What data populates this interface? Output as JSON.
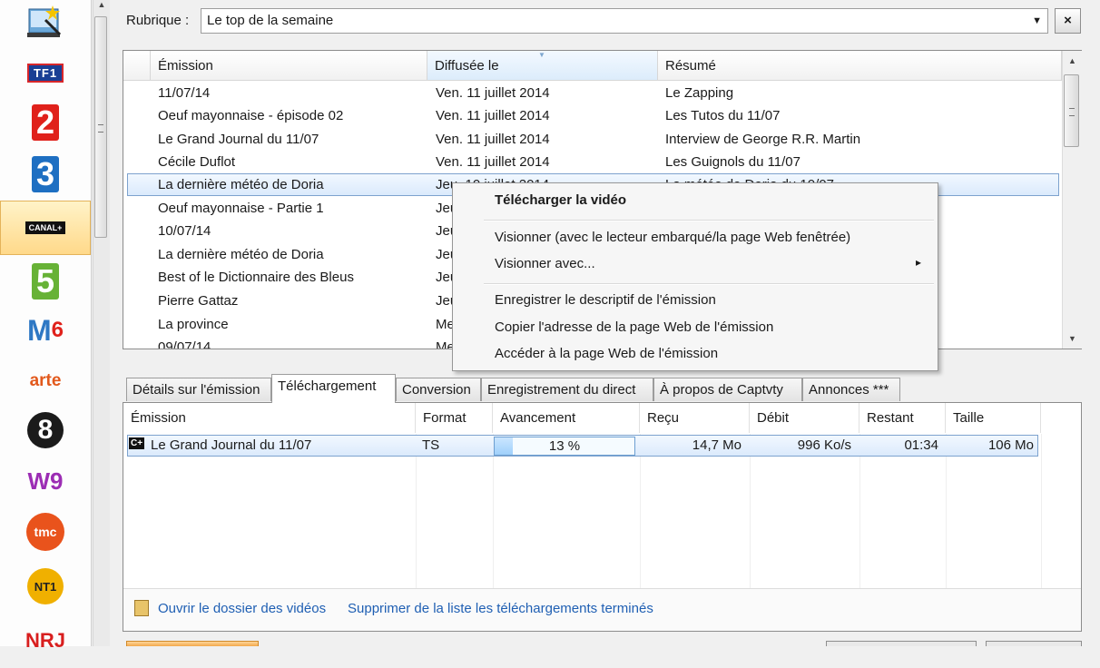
{
  "sidebar": {
    "channels": [
      {
        "name": "TF1",
        "logo": "tf1-logo",
        "color": "#1a3f94"
      },
      {
        "name": "2",
        "logo": "france2-logo",
        "color": "#e0211b"
      },
      {
        "name": "3",
        "logo": "france3-logo",
        "color": "#1e6fc2"
      },
      {
        "name": "CANAL+",
        "logo": "canalplus-logo",
        "color": "#111111",
        "selected": true
      },
      {
        "name": "5",
        "logo": "france5-logo",
        "color": "#67b236"
      },
      {
        "name": "6",
        "logo": "m6-logo",
        "color": "#2f78c4"
      },
      {
        "name": "arte",
        "logo": "arte-logo",
        "color": "#e2591c"
      },
      {
        "name": "8",
        "logo": "d8-logo",
        "color": "#1b1b1b"
      },
      {
        "name": "W9",
        "logo": "w9-logo",
        "color": "#9c2db4"
      },
      {
        "name": "tmc",
        "logo": "tmc-logo",
        "color": "#e9531c"
      },
      {
        "name": "NT1",
        "logo": "nt1-logo",
        "color": "#f0b000"
      },
      {
        "name": "NRJ",
        "logo": "nrj12-logo",
        "color": "#d81e1e"
      }
    ]
  },
  "rubrique": {
    "label": "Rubrique :",
    "value": "Le top de la semaine",
    "close": "×"
  },
  "list": {
    "columns": [
      "Émission",
      "Diffusée le",
      "Résumé"
    ],
    "rows": [
      {
        "emission": "11/07/14",
        "date": "Ven. 11 juillet 2014",
        "resume": "Le Zapping"
      },
      {
        "emission": "Oeuf mayonnaise - épisode 02",
        "date": "Ven. 11 juillet 2014",
        "resume": "Les Tutos du 11/07"
      },
      {
        "emission": "Le Grand Journal du 11/07",
        "date": "Ven. 11 juillet 2014",
        "resume": "Interview de George R.R. Martin"
      },
      {
        "emission": "Cécile Duflot",
        "date": "Ven. 11 juillet 2014",
        "resume": "Les Guignols du 11/07"
      },
      {
        "emission": "La dernière météo de Doria",
        "date": "Jeu. 10 juillet 2014",
        "resume": "La météo de Doria du 10/07"
      },
      {
        "emission": "Oeuf mayonnaise - Partie 1",
        "date": "Jeu",
        "resume": ""
      },
      {
        "emission": "10/07/14",
        "date": "Jeu",
        "resume": ""
      },
      {
        "emission": "La dernière météo de Doria",
        "date": "Jeu",
        "resume": ""
      },
      {
        "emission": "Best of le Dictionnaire des Bleus",
        "date": "Jeu",
        "resume": ""
      },
      {
        "emission": "Pierre Gattaz",
        "date": "Jeu",
        "resume": ""
      },
      {
        "emission": "La province",
        "date": "Me",
        "resume": ""
      },
      {
        "emission": "09/07/14",
        "date": "Me",
        "resume": ""
      }
    ]
  },
  "context_menu": {
    "items": [
      {
        "label": "Télécharger la vidéo",
        "bold": true
      },
      {
        "label": "Visionner (avec le lecteur embarqué/la page Web fenêtrée)"
      },
      {
        "label": "Visionner avec...",
        "submenu": "▸"
      },
      {
        "label": "Enregistrer le descriptif de l'émission"
      },
      {
        "label": "Copier l'adresse de la page Web de l'émission"
      },
      {
        "label": "Accéder à la page Web de l'émission"
      }
    ]
  },
  "tabs": [
    {
      "label": "Détails sur l'émission"
    },
    {
      "label": "Téléchargement",
      "active": true
    },
    {
      "label": "Conversion"
    },
    {
      "label": "Enregistrement du direct"
    },
    {
      "label": "À propos de Captvty"
    },
    {
      "label": "Annonces ***"
    }
  ],
  "downloads": {
    "columns": [
      "Émission",
      "Format",
      "Avancement",
      "Reçu",
      "Débit",
      "Restant",
      "Taille"
    ],
    "rows": [
      {
        "icon": "canalplus-icon",
        "emission": "Le Grand Journal du 11/07",
        "format": "TS",
        "progress": 13,
        "progress_label": "13 %",
        "recu": "14,7 Mo",
        "debit": "996 Ko/s",
        "restant": "01:34",
        "taille": "106 Mo"
      }
    ],
    "footer": {
      "open_folder": "Ouvrir le dossier des vidéos",
      "clear_finished": "Supprimer de la liste les téléchargements terminés"
    }
  },
  "colors": {
    "accent": "#1f5fb3",
    "selection": "#dbeafc",
    "progress": "#9fd0fb"
  }
}
